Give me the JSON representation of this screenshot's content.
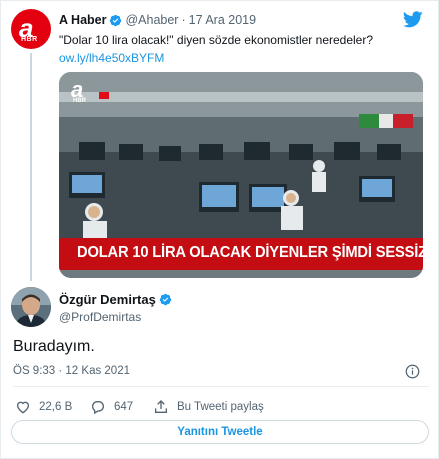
{
  "quoted_tweet": {
    "name": "A Haber",
    "handle": "@Ahaber",
    "separator": "·",
    "date": "17 Ara 2019",
    "text": "\"Dolar 10 lira olacak!\" diyen sözde ekonomistler neredeler?",
    "link": "ow.ly/lh4e50xBYFM",
    "avatar_mark": "a",
    "avatar_sub": "HBR",
    "media": {
      "banner": "DOLAR 10 LİRA OLACAK DİYENLER ŞİMDİ SESSİZ",
      "channel_mark": "a",
      "channel_sub": "HBR"
    }
  },
  "tweet": {
    "name": "Özgür Demirtaş",
    "handle": "@ProfDemirtas",
    "text": "Buradayım.",
    "timestamp": "ÖS 9:33 · 12 Kas 2021"
  },
  "actions": {
    "likes": "22,6 B",
    "replies": "647",
    "share_label": "Bu Tweeti paylaş"
  },
  "reply_button": "Yanıtını Tweetle",
  "icons": {
    "verified": "verified-badge-icon",
    "logo": "twitter-bird-icon",
    "info": "info-icon",
    "like": "heart-icon",
    "reply": "reply-bubble-icon",
    "share": "share-icon"
  },
  "colors": {
    "link": "#1b95e0",
    "verified": "#1d9bf0",
    "brand_red": "#e3000f",
    "banner_red": "#c40d12"
  }
}
